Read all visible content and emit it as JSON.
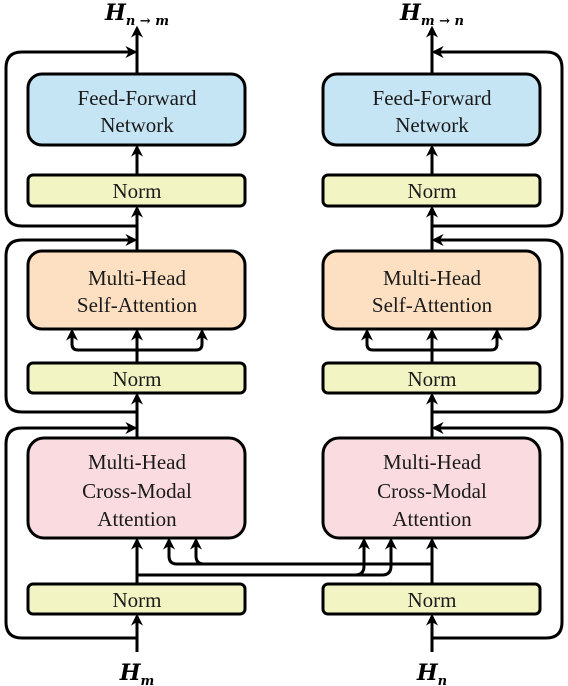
{
  "diagram": {
    "type": "cross-modal transformer block",
    "colors": {
      "ffn": "#c5e5f5",
      "self_attention": "#fde0c2",
      "cross_attention": "#fadbe0",
      "norm": "#f2f4c4",
      "stroke": "#000000"
    },
    "left": {
      "output_label": {
        "base": "H",
        "sub": "n → m"
      },
      "input_label": {
        "base": "H",
        "sub": "m"
      },
      "ffn": [
        "Feed-Forward",
        "Network"
      ],
      "norm_top": "Norm",
      "self_attention": [
        "Multi-Head",
        "Self-Attention"
      ],
      "norm_mid": "Norm",
      "cross_attention": [
        "Multi-Head",
        "Cross-Modal",
        "Attention"
      ],
      "norm_bottom": "Norm"
    },
    "right": {
      "output_label": {
        "base": "H",
        "sub": "m → n"
      },
      "input_label": {
        "base": "H",
        "sub": "n"
      },
      "ffn": [
        "Feed-Forward",
        "Network"
      ],
      "norm_top": "Norm",
      "self_attention": [
        "Multi-Head",
        "Self-Attention"
      ],
      "norm_mid": "Norm",
      "cross_attention": [
        "Multi-Head",
        "Cross-Modal",
        "Attention"
      ],
      "norm_bottom": "Norm"
    }
  }
}
